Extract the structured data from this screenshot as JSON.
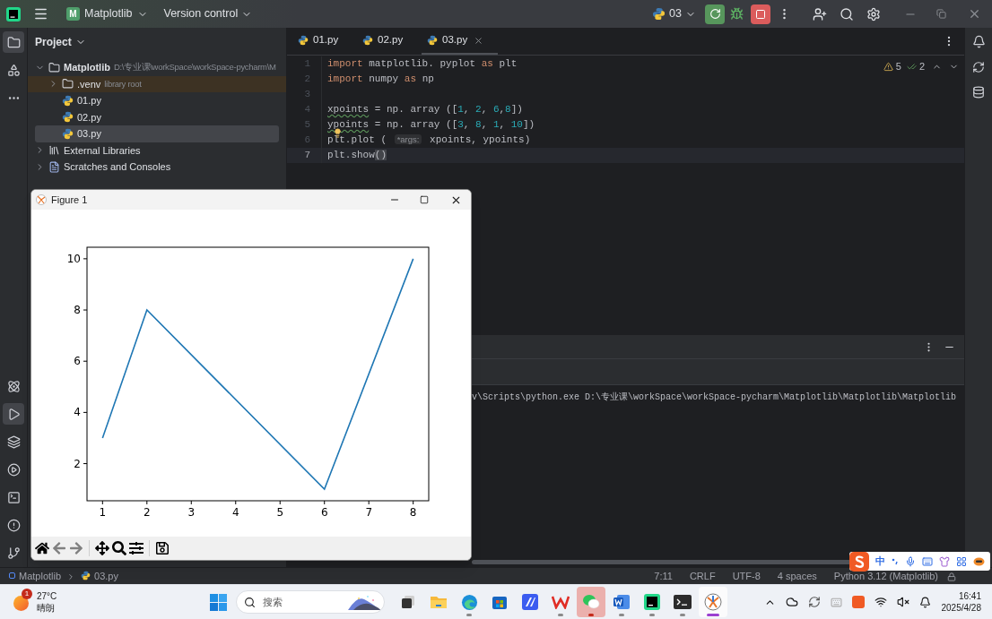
{
  "title_bar": {
    "app_badge": "M",
    "project": "Matplotlib",
    "vcs": "Version control",
    "run_config": "03"
  },
  "left_toolbar": {
    "top": [
      {
        "selected": true
      },
      {
        "selected": false
      },
      {
        "selected": false
      }
    ],
    "bottom": [
      {
        "selected": false
      },
      {
        "selected": true
      },
      {
        "selected": false
      },
      {
        "selected": false
      },
      {
        "selected": false
      },
      {
        "selected": false
      },
      {
        "selected": false
      }
    ]
  },
  "project_panel": {
    "title": "Project",
    "tree": [
      {
        "label": "Matplotlib",
        "kind": "folder",
        "note": "D:\\专业课\\workSpace\\workSpace-pycharm\\M",
        "expanded": true,
        "selected": false,
        "highlighted": false,
        "children": [
          {
            "label": ".venv",
            "kind": "folder",
            "note": "library root",
            "expanded": false,
            "selected": false,
            "highlighted": true
          },
          {
            "label": "01.py",
            "kind": "file",
            "selected": false,
            "highlighted": false
          },
          {
            "label": "02.py",
            "kind": "file",
            "selected": false,
            "highlighted": false
          },
          {
            "label": "03.py",
            "kind": "file",
            "selected": true,
            "highlighted": false
          }
        ]
      },
      {
        "label": "External Libraries",
        "kind": "library",
        "expanded": false,
        "selected": false,
        "highlighted": false
      },
      {
        "label": "Scratches and Consoles",
        "kind": "scratches",
        "expanded": false,
        "selected": false,
        "highlighted": false
      }
    ]
  },
  "editor": {
    "tabs": [
      {
        "label": "01.py",
        "selected": false
      },
      {
        "label": "02.py",
        "selected": false
      },
      {
        "label": "03.py",
        "selected": true
      }
    ],
    "inspections": {
      "warnings": "5",
      "weak_warnings": "2"
    },
    "lines": [
      {
        "number": "1",
        "current": false,
        "bulb": false,
        "tokens": [
          {
            "kind": "kw",
            "text": "import"
          },
          {
            "kind": "plain",
            "text": " matplotlib. pyplot "
          },
          {
            "kind": "kw",
            "text": "as"
          },
          {
            "kind": "plain",
            "text": " plt"
          }
        ]
      },
      {
        "number": "2",
        "current": false,
        "bulb": false,
        "tokens": [
          {
            "kind": "kw",
            "text": "import"
          },
          {
            "kind": "plain",
            "text": " numpy "
          },
          {
            "kind": "kw",
            "text": "as"
          },
          {
            "kind": "plain",
            "text": " np"
          }
        ]
      },
      {
        "number": "3",
        "current": false,
        "bulb": false
      },
      {
        "number": "4",
        "current": false,
        "bulb": false,
        "tokens": [
          {
            "kind": "warn",
            "text": "xpoints"
          },
          {
            "kind": "plain",
            "text": " = np. array (["
          },
          {
            "kind": "num",
            "text": "1"
          },
          {
            "kind": "plain",
            "text": ", "
          },
          {
            "kind": "num",
            "text": "2"
          },
          {
            "kind": "plain",
            "text": ", "
          },
          {
            "kind": "num",
            "text": "6"
          },
          {
            "kind": "plain",
            "text": ","
          },
          {
            "kind": "num",
            "text": "8"
          },
          {
            "kind": "plain",
            "text": "])"
          }
        ]
      },
      {
        "number": "5",
        "current": false,
        "bulb": false,
        "tokens": [
          {
            "kind": "warn",
            "text": "ypoints"
          },
          {
            "kind": "plain",
            "text": " = np. array (["
          },
          {
            "kind": "num",
            "text": "3"
          },
          {
            "kind": "plain",
            "text": ", "
          },
          {
            "kind": "num",
            "text": "8"
          },
          {
            "kind": "plain",
            "text": ", "
          },
          {
            "kind": "num",
            "text": "1"
          },
          {
            "kind": "plain",
            "text": ", "
          },
          {
            "kind": "num",
            "text": "10"
          },
          {
            "kind": "plain",
            "text": "])"
          }
        ]
      },
      {
        "number": "6",
        "current": false,
        "bulb": true,
        "tokens": [
          {
            "kind": "plain",
            "text": "plt.plot ( "
          },
          {
            "kind": "hint",
            "text": "*args:"
          },
          {
            "kind": "plain",
            "text": " xpoints, ypoints)"
          }
        ]
      },
      {
        "number": "7",
        "current": true,
        "bulb": false,
        "tokens": [
          {
            "kind": "plain",
            "text": "plt.show"
          },
          {
            "kind": "match",
            "text": "()"
          }
        ]
      }
    ]
  },
  "run_panel": {
    "console_line": "v\\Scripts\\python.exe D:\\专业课\\workSpace\\workSpace-pycharm\\Matplotlib\\Matplotlib\\Matplotlib"
  },
  "figure": {
    "title": "Figure 1",
    "chart_data": {
      "type": "line",
      "x": [
        1,
        2,
        6,
        8
      ],
      "series": [
        {
          "color": "#1f77b4",
          "values": [
            3,
            8,
            1,
            10
          ]
        }
      ],
      "xlim": [
        0.65,
        8.35
      ],
      "ylim": [
        0.55,
        10.45
      ],
      "xticks": [
        1,
        2,
        3,
        4,
        5,
        6,
        7,
        8
      ],
      "yticks": [
        2,
        4,
        6,
        8,
        10
      ]
    },
    "toolbar": [
      {
        "disabled": false
      },
      {
        "disabled": true
      },
      {
        "disabled": true
      },
      {
        "disabled": false
      },
      {
        "disabled": false
      },
      {
        "disabled": false
      },
      {
        "disabled": false
      }
    ]
  },
  "status_bar": {
    "breadcrumbs": [
      "Matplotlib",
      "03.py"
    ],
    "items": [
      "7:11",
      "CRLF",
      "UTF-8",
      "4 spaces",
      "Python 3.12 (Matplotlib)"
    ]
  },
  "ime_bar": {
    "mode": "中"
  },
  "taskbar": {
    "weather": {
      "badge": "1",
      "temperature": "27°C",
      "condition": "晴朗"
    },
    "search": {
      "placeholder": "搜索"
    },
    "apps": [
      {
        "running": false,
        "selected": false,
        "attention": false
      },
      {
        "running": false,
        "selected": false,
        "attention": false
      },
      {
        "running": true,
        "selected": false,
        "attention": false
      },
      {
        "running": false,
        "selected": false,
        "attention": false
      },
      {
        "running": false,
        "selected": false,
        "attention": false
      },
      {
        "running": true,
        "selected": false,
        "attention": false
      },
      {
        "running": true,
        "selected": false,
        "attention": true
      },
      {
        "running": true,
        "selected": false,
        "attention": false
      },
      {
        "running": true,
        "selected": false,
        "attention": false
      },
      {
        "running": true,
        "selected": false,
        "attention": false
      },
      {
        "running": true,
        "selected": true,
        "attention": false
      }
    ],
    "time": "16:41",
    "date": "2025/4/28"
  }
}
